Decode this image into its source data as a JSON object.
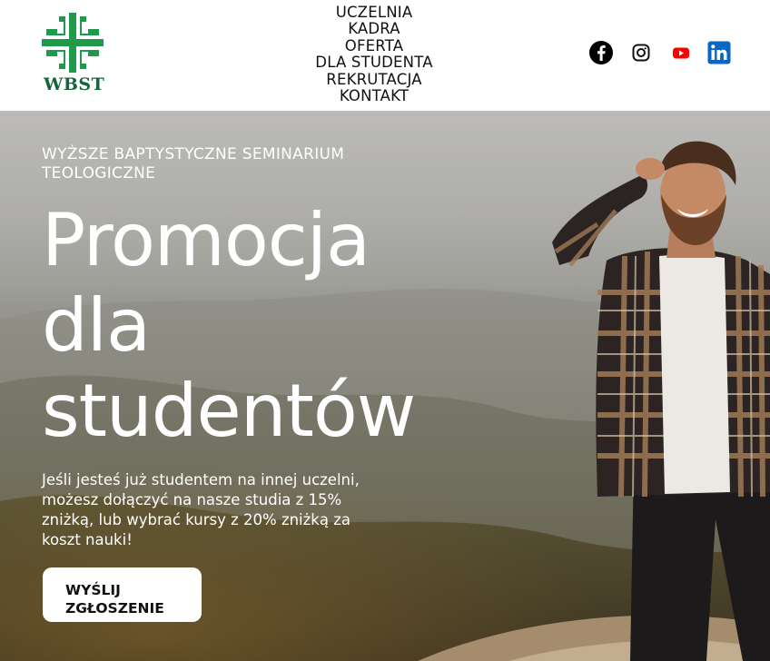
{
  "header": {
    "logo_text": "WBST",
    "nav": [
      {
        "label": "UCZELNIA"
      },
      {
        "label": "KADRA"
      },
      {
        "label": "OFERTA"
      },
      {
        "label": "DLA STUDENTA"
      },
      {
        "label": "REKRUTACJA"
      },
      {
        "label": "KONTAKT"
      }
    ],
    "social": [
      {
        "icon": "facebook-icon"
      },
      {
        "icon": "instagram-icon"
      },
      {
        "icon": "youtube-icon"
      },
      {
        "icon": "linkedin-icon"
      }
    ]
  },
  "hero": {
    "eyebrow": "WYŻSZE BAPTYSTYCZNE SEMINARIUM TEOLOGICZNE",
    "title_lines": [
      "Promocja",
      "dla",
      "studentów"
    ],
    "text": "Jeśli jesteś już studentem na innej uczelni, możesz dołączyć na nasze studia z 15% zniżką, lub wybrać kursy z 20% zniżką za koszt nauki!",
    "cta_label": "WYŚLIJ ZGŁOSZENIE"
  },
  "colors": {
    "brand_green": "#17643a",
    "logo_green": "#1e9a4a",
    "youtube_red": "#ff0000",
    "linkedin_blue": "#0a66c2"
  }
}
